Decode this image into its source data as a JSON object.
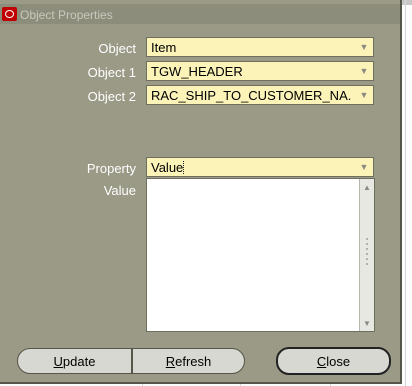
{
  "window": {
    "title": "Object Properties"
  },
  "fields": {
    "object": {
      "label": "Object",
      "value": "Item"
    },
    "object1": {
      "label": "Object 1",
      "value": "TGW_HEADER"
    },
    "object2": {
      "label": "Object 2",
      "value": "RAC_SHIP_TO_CUSTOMER_NA..."
    },
    "property": {
      "label": "Property",
      "value": "Value"
    },
    "value": {
      "label": "Value",
      "value": ""
    }
  },
  "buttons": {
    "update_first": "U",
    "update_rest": "pdate",
    "refresh_first": "R",
    "refresh_rest": "efresh",
    "close_first": "C",
    "close_rest": "lose"
  },
  "icons": {
    "title": "oracle-logo-icon",
    "dropdown": "chevron-down-icon",
    "scroll_up": "scroll-up-icon",
    "scroll_down": "scroll-down-icon"
  },
  "colors": {
    "dialog_bg": "#9a9a87",
    "field_bg": "#fbf3b8",
    "label_text": "#ffffff",
    "button_bg": "#d8d8d2"
  }
}
